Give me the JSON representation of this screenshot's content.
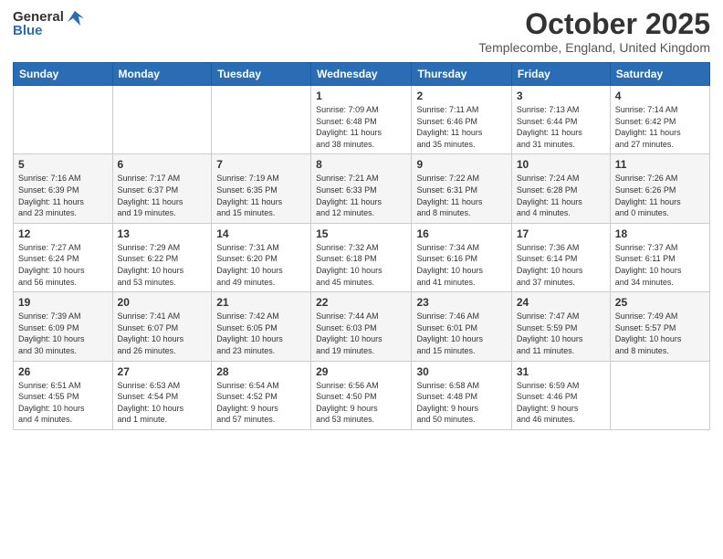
{
  "header": {
    "logo_general": "General",
    "logo_blue": "Blue",
    "month": "October 2025",
    "location": "Templecombe, England, United Kingdom"
  },
  "weekdays": [
    "Sunday",
    "Monday",
    "Tuesday",
    "Wednesday",
    "Thursday",
    "Friday",
    "Saturday"
  ],
  "weeks": [
    [
      {
        "day": "",
        "info": ""
      },
      {
        "day": "",
        "info": ""
      },
      {
        "day": "",
        "info": ""
      },
      {
        "day": "1",
        "info": "Sunrise: 7:09 AM\nSunset: 6:48 PM\nDaylight: 11 hours\nand 38 minutes."
      },
      {
        "day": "2",
        "info": "Sunrise: 7:11 AM\nSunset: 6:46 PM\nDaylight: 11 hours\nand 35 minutes."
      },
      {
        "day": "3",
        "info": "Sunrise: 7:13 AM\nSunset: 6:44 PM\nDaylight: 11 hours\nand 31 minutes."
      },
      {
        "day": "4",
        "info": "Sunrise: 7:14 AM\nSunset: 6:42 PM\nDaylight: 11 hours\nand 27 minutes."
      }
    ],
    [
      {
        "day": "5",
        "info": "Sunrise: 7:16 AM\nSunset: 6:39 PM\nDaylight: 11 hours\nand 23 minutes."
      },
      {
        "day": "6",
        "info": "Sunrise: 7:17 AM\nSunset: 6:37 PM\nDaylight: 11 hours\nand 19 minutes."
      },
      {
        "day": "7",
        "info": "Sunrise: 7:19 AM\nSunset: 6:35 PM\nDaylight: 11 hours\nand 15 minutes."
      },
      {
        "day": "8",
        "info": "Sunrise: 7:21 AM\nSunset: 6:33 PM\nDaylight: 11 hours\nand 12 minutes."
      },
      {
        "day": "9",
        "info": "Sunrise: 7:22 AM\nSunset: 6:31 PM\nDaylight: 11 hours\nand 8 minutes."
      },
      {
        "day": "10",
        "info": "Sunrise: 7:24 AM\nSunset: 6:28 PM\nDaylight: 11 hours\nand 4 minutes."
      },
      {
        "day": "11",
        "info": "Sunrise: 7:26 AM\nSunset: 6:26 PM\nDaylight: 11 hours\nand 0 minutes."
      }
    ],
    [
      {
        "day": "12",
        "info": "Sunrise: 7:27 AM\nSunset: 6:24 PM\nDaylight: 10 hours\nand 56 minutes."
      },
      {
        "day": "13",
        "info": "Sunrise: 7:29 AM\nSunset: 6:22 PM\nDaylight: 10 hours\nand 53 minutes."
      },
      {
        "day": "14",
        "info": "Sunrise: 7:31 AM\nSunset: 6:20 PM\nDaylight: 10 hours\nand 49 minutes."
      },
      {
        "day": "15",
        "info": "Sunrise: 7:32 AM\nSunset: 6:18 PM\nDaylight: 10 hours\nand 45 minutes."
      },
      {
        "day": "16",
        "info": "Sunrise: 7:34 AM\nSunset: 6:16 PM\nDaylight: 10 hours\nand 41 minutes."
      },
      {
        "day": "17",
        "info": "Sunrise: 7:36 AM\nSunset: 6:14 PM\nDaylight: 10 hours\nand 37 minutes."
      },
      {
        "day": "18",
        "info": "Sunrise: 7:37 AM\nSunset: 6:11 PM\nDaylight: 10 hours\nand 34 minutes."
      }
    ],
    [
      {
        "day": "19",
        "info": "Sunrise: 7:39 AM\nSunset: 6:09 PM\nDaylight: 10 hours\nand 30 minutes."
      },
      {
        "day": "20",
        "info": "Sunrise: 7:41 AM\nSunset: 6:07 PM\nDaylight: 10 hours\nand 26 minutes."
      },
      {
        "day": "21",
        "info": "Sunrise: 7:42 AM\nSunset: 6:05 PM\nDaylight: 10 hours\nand 23 minutes."
      },
      {
        "day": "22",
        "info": "Sunrise: 7:44 AM\nSunset: 6:03 PM\nDaylight: 10 hours\nand 19 minutes."
      },
      {
        "day": "23",
        "info": "Sunrise: 7:46 AM\nSunset: 6:01 PM\nDaylight: 10 hours\nand 15 minutes."
      },
      {
        "day": "24",
        "info": "Sunrise: 7:47 AM\nSunset: 5:59 PM\nDaylight: 10 hours\nand 11 minutes."
      },
      {
        "day": "25",
        "info": "Sunrise: 7:49 AM\nSunset: 5:57 PM\nDaylight: 10 hours\nand 8 minutes."
      }
    ],
    [
      {
        "day": "26",
        "info": "Sunrise: 6:51 AM\nSunset: 4:55 PM\nDaylight: 10 hours\nand 4 minutes."
      },
      {
        "day": "27",
        "info": "Sunrise: 6:53 AM\nSunset: 4:54 PM\nDaylight: 10 hours\nand 1 minute."
      },
      {
        "day": "28",
        "info": "Sunrise: 6:54 AM\nSunset: 4:52 PM\nDaylight: 9 hours\nand 57 minutes."
      },
      {
        "day": "29",
        "info": "Sunrise: 6:56 AM\nSunset: 4:50 PM\nDaylight: 9 hours\nand 53 minutes."
      },
      {
        "day": "30",
        "info": "Sunrise: 6:58 AM\nSunset: 4:48 PM\nDaylight: 9 hours\nand 50 minutes."
      },
      {
        "day": "31",
        "info": "Sunrise: 6:59 AM\nSunset: 4:46 PM\nDaylight: 9 hours\nand 46 minutes."
      },
      {
        "day": "",
        "info": ""
      }
    ]
  ]
}
